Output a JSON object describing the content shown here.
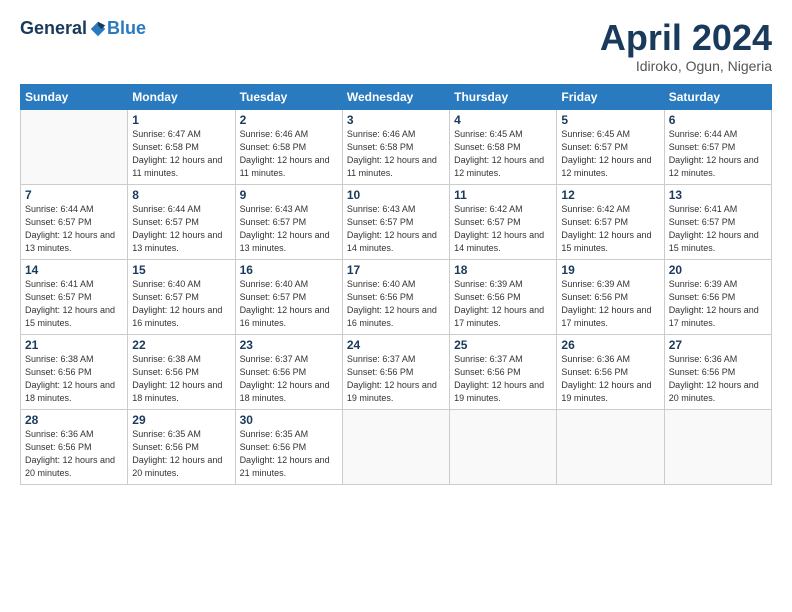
{
  "header": {
    "logo_general": "General",
    "logo_blue": "Blue",
    "month_title": "April 2024",
    "location": "Idiroko, Ogun, Nigeria"
  },
  "calendar": {
    "days_of_week": [
      "Sunday",
      "Monday",
      "Tuesday",
      "Wednesday",
      "Thursday",
      "Friday",
      "Saturday"
    ],
    "weeks": [
      [
        {
          "day": "",
          "sunrise": "",
          "sunset": "",
          "daylight": ""
        },
        {
          "day": "1",
          "sunrise": "Sunrise: 6:47 AM",
          "sunset": "Sunset: 6:58 PM",
          "daylight": "Daylight: 12 hours and 11 minutes."
        },
        {
          "day": "2",
          "sunrise": "Sunrise: 6:46 AM",
          "sunset": "Sunset: 6:58 PM",
          "daylight": "Daylight: 12 hours and 11 minutes."
        },
        {
          "day": "3",
          "sunrise": "Sunrise: 6:46 AM",
          "sunset": "Sunset: 6:58 PM",
          "daylight": "Daylight: 12 hours and 11 minutes."
        },
        {
          "day": "4",
          "sunrise": "Sunrise: 6:45 AM",
          "sunset": "Sunset: 6:58 PM",
          "daylight": "Daylight: 12 hours and 12 minutes."
        },
        {
          "day": "5",
          "sunrise": "Sunrise: 6:45 AM",
          "sunset": "Sunset: 6:57 PM",
          "daylight": "Daylight: 12 hours and 12 minutes."
        },
        {
          "day": "6",
          "sunrise": "Sunrise: 6:44 AM",
          "sunset": "Sunset: 6:57 PM",
          "daylight": "Daylight: 12 hours and 12 minutes."
        }
      ],
      [
        {
          "day": "7",
          "sunrise": "Sunrise: 6:44 AM",
          "sunset": "Sunset: 6:57 PM",
          "daylight": "Daylight: 12 hours and 13 minutes."
        },
        {
          "day": "8",
          "sunrise": "Sunrise: 6:44 AM",
          "sunset": "Sunset: 6:57 PM",
          "daylight": "Daylight: 12 hours and 13 minutes."
        },
        {
          "day": "9",
          "sunrise": "Sunrise: 6:43 AM",
          "sunset": "Sunset: 6:57 PM",
          "daylight": "Daylight: 12 hours and 13 minutes."
        },
        {
          "day": "10",
          "sunrise": "Sunrise: 6:43 AM",
          "sunset": "Sunset: 6:57 PM",
          "daylight": "Daylight: 12 hours and 14 minutes."
        },
        {
          "day": "11",
          "sunrise": "Sunrise: 6:42 AM",
          "sunset": "Sunset: 6:57 PM",
          "daylight": "Daylight: 12 hours and 14 minutes."
        },
        {
          "day": "12",
          "sunrise": "Sunrise: 6:42 AM",
          "sunset": "Sunset: 6:57 PM",
          "daylight": "Daylight: 12 hours and 15 minutes."
        },
        {
          "day": "13",
          "sunrise": "Sunrise: 6:41 AM",
          "sunset": "Sunset: 6:57 PM",
          "daylight": "Daylight: 12 hours and 15 minutes."
        }
      ],
      [
        {
          "day": "14",
          "sunrise": "Sunrise: 6:41 AM",
          "sunset": "Sunset: 6:57 PM",
          "daylight": "Daylight: 12 hours and 15 minutes."
        },
        {
          "day": "15",
          "sunrise": "Sunrise: 6:40 AM",
          "sunset": "Sunset: 6:57 PM",
          "daylight": "Daylight: 12 hours and 16 minutes."
        },
        {
          "day": "16",
          "sunrise": "Sunrise: 6:40 AM",
          "sunset": "Sunset: 6:57 PM",
          "daylight": "Daylight: 12 hours and 16 minutes."
        },
        {
          "day": "17",
          "sunrise": "Sunrise: 6:40 AM",
          "sunset": "Sunset: 6:56 PM",
          "daylight": "Daylight: 12 hours and 16 minutes."
        },
        {
          "day": "18",
          "sunrise": "Sunrise: 6:39 AM",
          "sunset": "Sunset: 6:56 PM",
          "daylight": "Daylight: 12 hours and 17 minutes."
        },
        {
          "day": "19",
          "sunrise": "Sunrise: 6:39 AM",
          "sunset": "Sunset: 6:56 PM",
          "daylight": "Daylight: 12 hours and 17 minutes."
        },
        {
          "day": "20",
          "sunrise": "Sunrise: 6:39 AM",
          "sunset": "Sunset: 6:56 PM",
          "daylight": "Daylight: 12 hours and 17 minutes."
        }
      ],
      [
        {
          "day": "21",
          "sunrise": "Sunrise: 6:38 AM",
          "sunset": "Sunset: 6:56 PM",
          "daylight": "Daylight: 12 hours and 18 minutes."
        },
        {
          "day": "22",
          "sunrise": "Sunrise: 6:38 AM",
          "sunset": "Sunset: 6:56 PM",
          "daylight": "Daylight: 12 hours and 18 minutes."
        },
        {
          "day": "23",
          "sunrise": "Sunrise: 6:37 AM",
          "sunset": "Sunset: 6:56 PM",
          "daylight": "Daylight: 12 hours and 18 minutes."
        },
        {
          "day": "24",
          "sunrise": "Sunrise: 6:37 AM",
          "sunset": "Sunset: 6:56 PM",
          "daylight": "Daylight: 12 hours and 19 minutes."
        },
        {
          "day": "25",
          "sunrise": "Sunrise: 6:37 AM",
          "sunset": "Sunset: 6:56 PM",
          "daylight": "Daylight: 12 hours and 19 minutes."
        },
        {
          "day": "26",
          "sunrise": "Sunrise: 6:36 AM",
          "sunset": "Sunset: 6:56 PM",
          "daylight": "Daylight: 12 hours and 19 minutes."
        },
        {
          "day": "27",
          "sunrise": "Sunrise: 6:36 AM",
          "sunset": "Sunset: 6:56 PM",
          "daylight": "Daylight: 12 hours and 20 minutes."
        }
      ],
      [
        {
          "day": "28",
          "sunrise": "Sunrise: 6:36 AM",
          "sunset": "Sunset: 6:56 PM",
          "daylight": "Daylight: 12 hours and 20 minutes."
        },
        {
          "day": "29",
          "sunrise": "Sunrise: 6:35 AM",
          "sunset": "Sunset: 6:56 PM",
          "daylight": "Daylight: 12 hours and 20 minutes."
        },
        {
          "day": "30",
          "sunrise": "Sunrise: 6:35 AM",
          "sunset": "Sunset: 6:56 PM",
          "daylight": "Daylight: 12 hours and 21 minutes."
        },
        {
          "day": "",
          "sunrise": "",
          "sunset": "",
          "daylight": ""
        },
        {
          "day": "",
          "sunrise": "",
          "sunset": "",
          "daylight": ""
        },
        {
          "day": "",
          "sunrise": "",
          "sunset": "",
          "daylight": ""
        },
        {
          "day": "",
          "sunrise": "",
          "sunset": "",
          "daylight": ""
        }
      ]
    ]
  }
}
